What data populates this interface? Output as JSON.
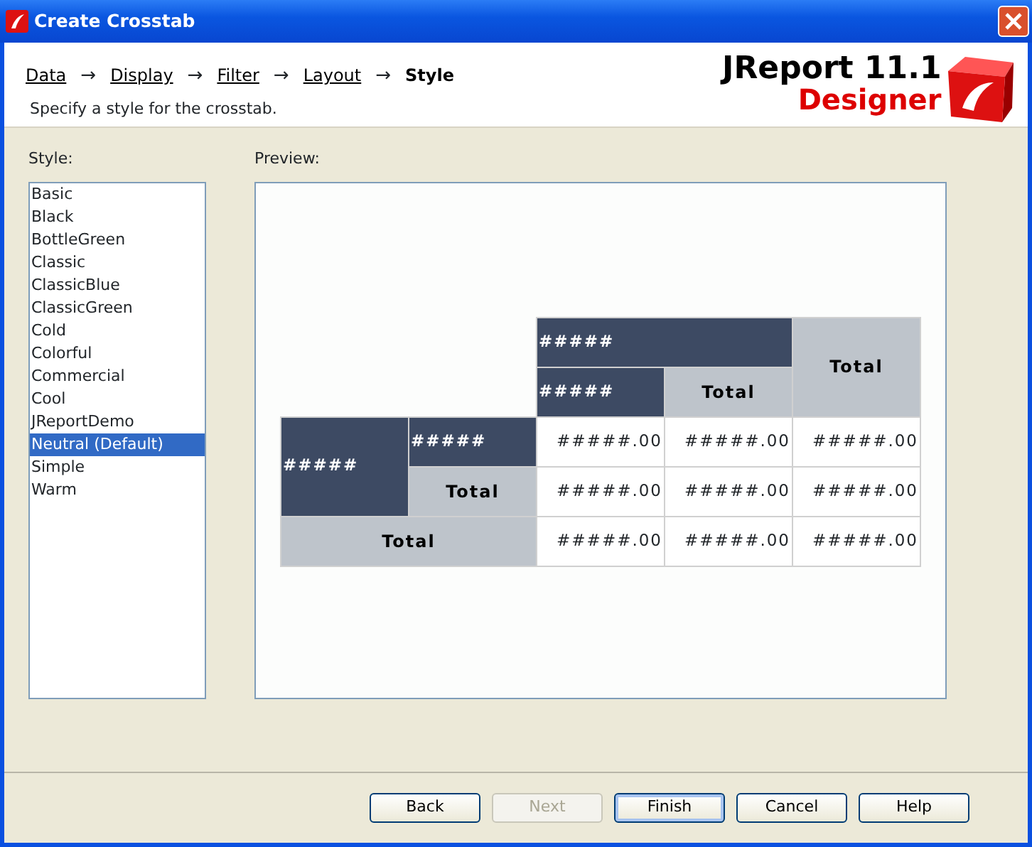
{
  "window": {
    "title": "Create Crosstab"
  },
  "steps": [
    {
      "label": "Data",
      "selected": false
    },
    {
      "arrow": "→",
      "label": "Display",
      "selected": false
    },
    {
      "arrow": "→",
      "label": "Filter",
      "selected": false
    },
    {
      "arrow": "→",
      "label": "Layout",
      "selected": false
    },
    {
      "arrow": "→",
      "label": "Style",
      "selected": true
    }
  ],
  "subtitle": "Specify a style for the crosstab.",
  "logo": {
    "product": "JReport 11.1",
    "edition": "Designer"
  },
  "style_list": {
    "label": "Style:",
    "items": [
      {
        "label": "Basic",
        "selected": false
      },
      {
        "label": "Black",
        "selected": false
      },
      {
        "label": "BottleGreen",
        "selected": false
      },
      {
        "label": "Classic",
        "selected": false
      },
      {
        "label": "ClassicBlue",
        "selected": false
      },
      {
        "label": "ClassicGreen",
        "selected": false
      },
      {
        "label": "Cold",
        "selected": false
      },
      {
        "label": "Colorful",
        "selected": false
      },
      {
        "label": "Commercial",
        "selected": false
      },
      {
        "label": "Cool",
        "selected": false
      },
      {
        "label": "JReportDemo",
        "selected": false
      },
      {
        "label": "Neutral (Default)",
        "selected": true
      },
      {
        "label": "Simple",
        "selected": false
      },
      {
        "label": "Warm",
        "selected": false
      }
    ]
  },
  "preview": {
    "label": "Preview:",
    "rows": [
      [
        {
          "kind": "empty",
          "colspan": 2,
          "rowspan": 2
        },
        {
          "kind": "header",
          "text": "#####",
          "colspan": 2
        },
        {
          "kind": "total",
          "text": "Total",
          "rowspan": 2
        }
      ],
      [
        {
          "kind": "header",
          "text": "#####"
        },
        {
          "kind": "total",
          "text": "Total"
        }
      ],
      [
        {
          "kind": "header",
          "text": "#####",
          "rowspan": 2
        },
        {
          "kind": "header",
          "text": "#####"
        },
        {
          "kind": "value",
          "text": "#####.00"
        },
        {
          "kind": "value",
          "text": "#####.00"
        },
        {
          "kind": "value",
          "text": "#####.00"
        }
      ],
      [
        {
          "kind": "total",
          "text": "Total"
        },
        {
          "kind": "value",
          "text": "#####.00"
        },
        {
          "kind": "value",
          "text": "#####.00"
        },
        {
          "kind": "value",
          "text": "#####.00"
        }
      ],
      [
        {
          "kind": "total",
          "text": "Total",
          "colspan": 2
        },
        {
          "kind": "value",
          "text": "#####.00"
        },
        {
          "kind": "value",
          "text": "#####.00"
        },
        {
          "kind": "value",
          "text": "#####.00"
        }
      ]
    ]
  },
  "buttons": [
    {
      "label": "Back",
      "disabled": false,
      "default": false
    },
    {
      "label": "Next",
      "disabled": true,
      "default": false
    },
    {
      "label": "Finish",
      "disabled": false,
      "default": true
    },
    {
      "label": "Cancel",
      "disabled": false,
      "default": false
    },
    {
      "label": "Help",
      "disabled": false,
      "default": false
    }
  ]
}
